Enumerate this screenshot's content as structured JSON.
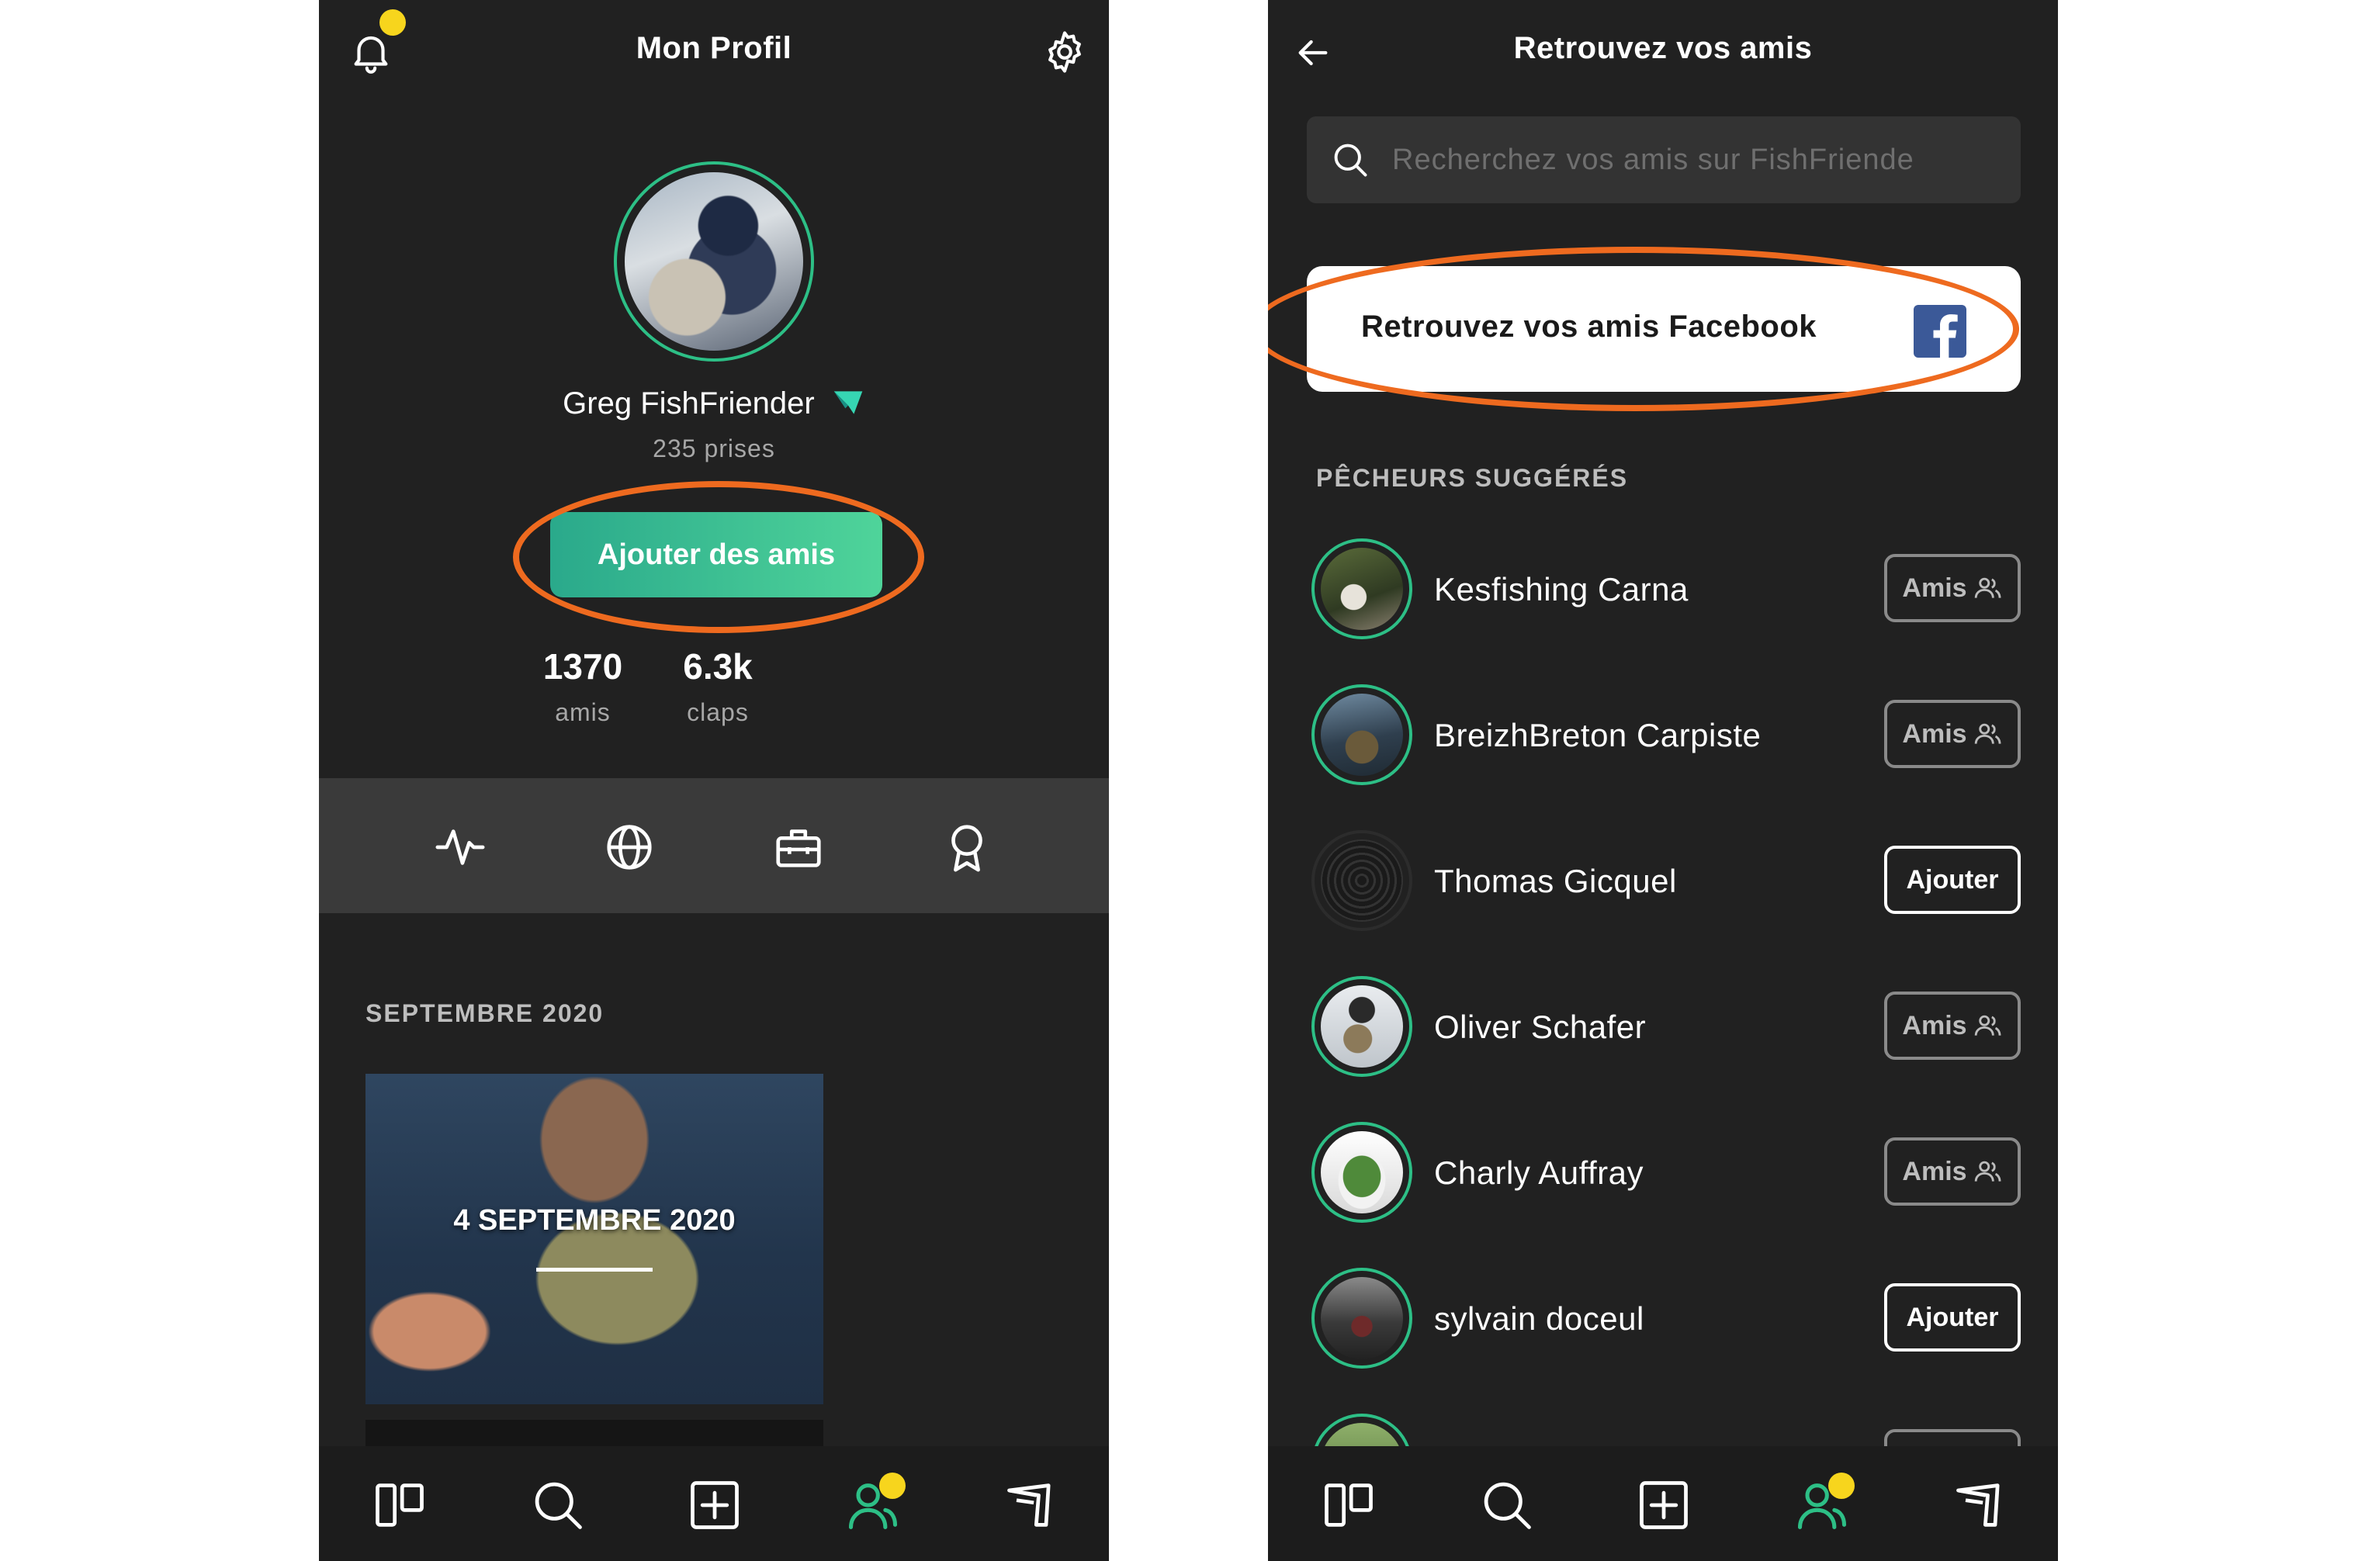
{
  "profile_screen": {
    "title": "Mon Profil",
    "user": {
      "name": "Greg FishFriender",
      "catches": "235 prises"
    },
    "add_friends_label": "Ajouter des amis",
    "stats": [
      {
        "value": "1370",
        "label": "amis"
      },
      {
        "value": "6.3k",
        "label": "claps"
      }
    ],
    "tabs": [
      "activity-icon",
      "globe-icon",
      "tackle-box-icon",
      "award-icon"
    ],
    "section_title": "SEPTEMBRE 2020",
    "feed_card_date": "4 SEPTEMBRE 2020"
  },
  "friends_screen": {
    "title": "Retrouvez vos amis",
    "search": {
      "placeholder": "Recherchez vos amis sur FishFriende",
      "value": ""
    },
    "facebook_label": "Retrouvez vos amis Facebook",
    "section_title": "PÊCHEURS SUGGÉRÉS",
    "suggested": [
      {
        "name": "Kesfishing Carna",
        "action": "Amis",
        "status": "friend"
      },
      {
        "name": "BreizhBreton Carpiste",
        "action": "Amis",
        "status": "friend"
      },
      {
        "name": "Thomas Gicquel",
        "action": "Ajouter",
        "status": "add"
      },
      {
        "name": "Oliver Schafer",
        "action": "Amis",
        "status": "friend"
      },
      {
        "name": "Charly Auffray",
        "action": "Amis",
        "status": "friend"
      },
      {
        "name": "sylvain doceul",
        "action": "Ajouter",
        "status": "add"
      }
    ]
  },
  "bottom_nav": [
    "feed-icon",
    "search-icon",
    "add-post-icon",
    "friends-icon",
    "shop-icon"
  ],
  "colors": {
    "background": "#212121",
    "accent_green": "#2dbf86",
    "notification_yellow": "#f7d51d",
    "highlight_orange": "#ee6a1f",
    "facebook_blue": "#3b5998"
  }
}
